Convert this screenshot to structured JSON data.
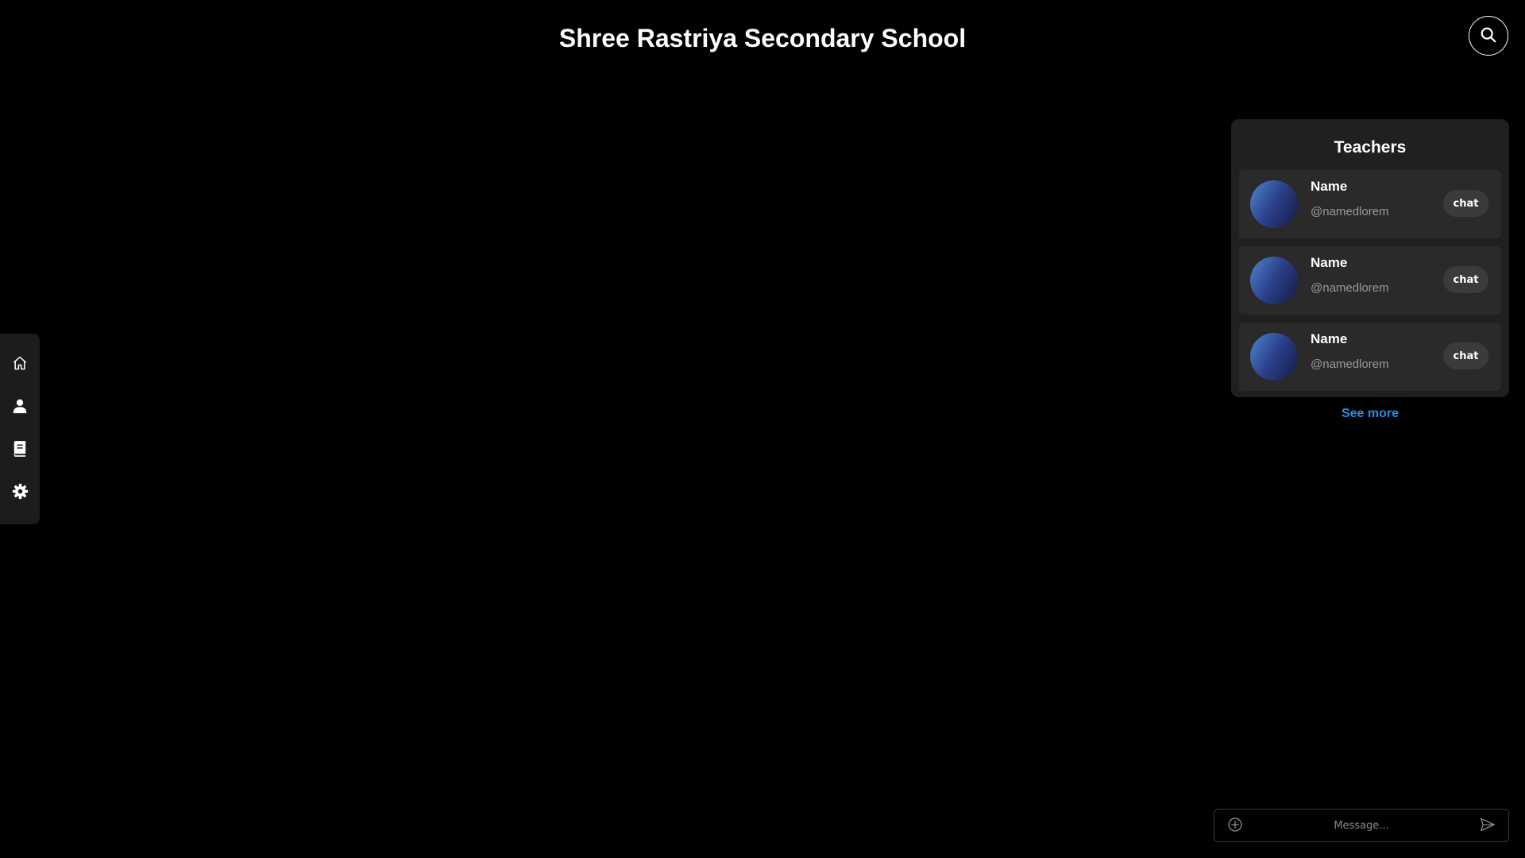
{
  "header": {
    "title": "Shree Rastriya Secondary School",
    "search_icon": "search-icon"
  },
  "sidebar": {
    "items": [
      {
        "icon": "home-icon",
        "name": "home"
      },
      {
        "icon": "user-icon",
        "name": "profile"
      },
      {
        "icon": "book-icon",
        "name": "courses"
      },
      {
        "icon": "gear-icon",
        "name": "settings"
      }
    ]
  },
  "teachers": {
    "title": "Teachers",
    "list": [
      {
        "name": "Name",
        "handle": "@namedlorem",
        "action": "chat"
      },
      {
        "name": "Name",
        "handle": "@namedlorem",
        "action": "chat"
      },
      {
        "name": "Name",
        "handle": "@namedlorem",
        "action": "chat"
      }
    ],
    "see_more": "See more"
  },
  "message_bar": {
    "placeholder": "Message...",
    "attach_icon": "plus-circle-icon",
    "send_icon": "send-icon"
  },
  "colors": {
    "background": "#000000",
    "panel": "#202020",
    "card": "#2a2a2a",
    "link": "#2b8ce6",
    "avatar_gradient": [
      "#4f86d0",
      "#141a45"
    ]
  }
}
